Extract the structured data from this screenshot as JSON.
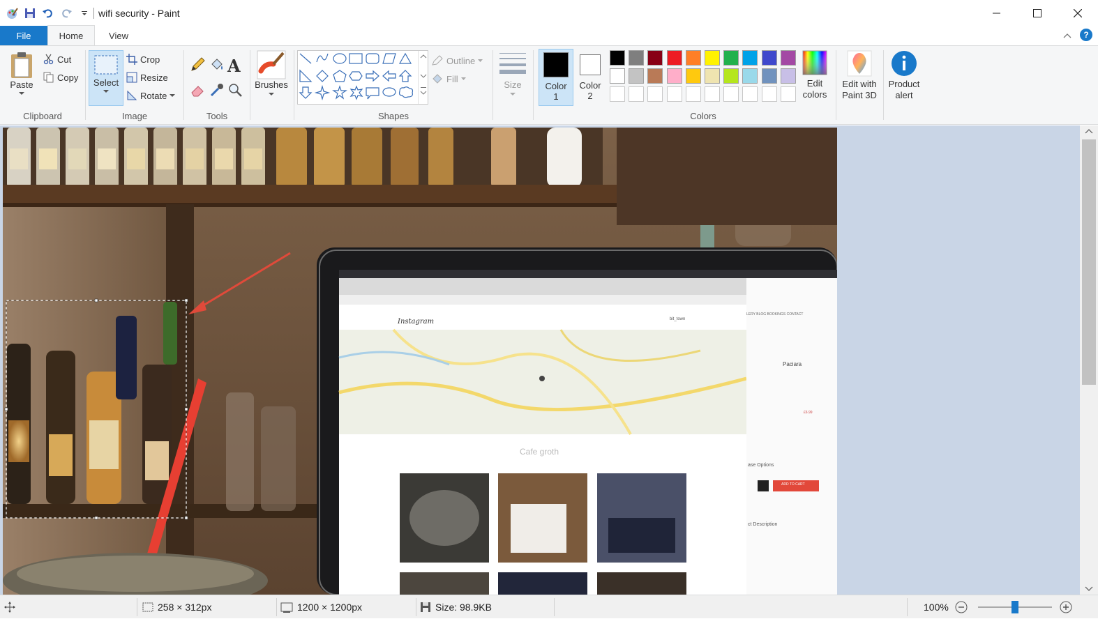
{
  "window": {
    "title": "wifi security - Paint"
  },
  "tabs": {
    "file": "File",
    "home": "Home",
    "view": "View"
  },
  "ribbon": {
    "clipboard": {
      "label": "Clipboard",
      "paste": "Paste",
      "cut": "Cut",
      "copy": "Copy"
    },
    "image": {
      "label": "Image",
      "select": "Select",
      "crop": "Crop",
      "resize": "Resize",
      "rotate": "Rotate"
    },
    "tools": {
      "label": "Tools"
    },
    "brushes": {
      "label": "Brushes"
    },
    "shapes": {
      "label": "Shapes",
      "outline": "Outline",
      "fill": "Fill"
    },
    "size": {
      "label": "Size"
    },
    "color1": {
      "line1": "Color",
      "line2": "1",
      "value": "#000000"
    },
    "color2": {
      "line1": "Color",
      "line2": "2",
      "value": "#ffffff"
    },
    "colors": {
      "label": "Colors",
      "row1": [
        "#000000",
        "#7f7f7f",
        "#880015",
        "#ed1c24",
        "#ff7f27",
        "#fff200",
        "#22b14c",
        "#00a2e8",
        "#3f48cc",
        "#a349a4"
      ],
      "row2": [
        "#ffffff",
        "#c3c3c3",
        "#b97a57",
        "#ffaec9",
        "#ffc90e",
        "#efe4b0",
        "#b5e61d",
        "#99d9ea",
        "#7092be",
        "#c8bfe7"
      ]
    },
    "edit_colors": {
      "line1": "Edit",
      "line2": "colors"
    },
    "paint3d": {
      "line1": "Edit with",
      "line2": "Paint 3D"
    },
    "product_alert": {
      "line1": "Product",
      "line2": "alert"
    }
  },
  "photo": {
    "browser_app": "Instagram",
    "browser_user": "bit_town",
    "cafe_name": "Cafe groth",
    "shop_product": "Paciara",
    "shop_price": "£6.99",
    "shop_button": "ADD TO CART",
    "shop_options": "ase Options",
    "shop_description": "ct Description",
    "shop_nav": "LERY   BLOG   BOOKINGS   CONTACT"
  },
  "status": {
    "selection_size": "258 × 312px",
    "image_size": "1200 × 1200px",
    "file_size": "Size: 98.9KB",
    "zoom": "100%"
  },
  "zoom_level": 0.5
}
